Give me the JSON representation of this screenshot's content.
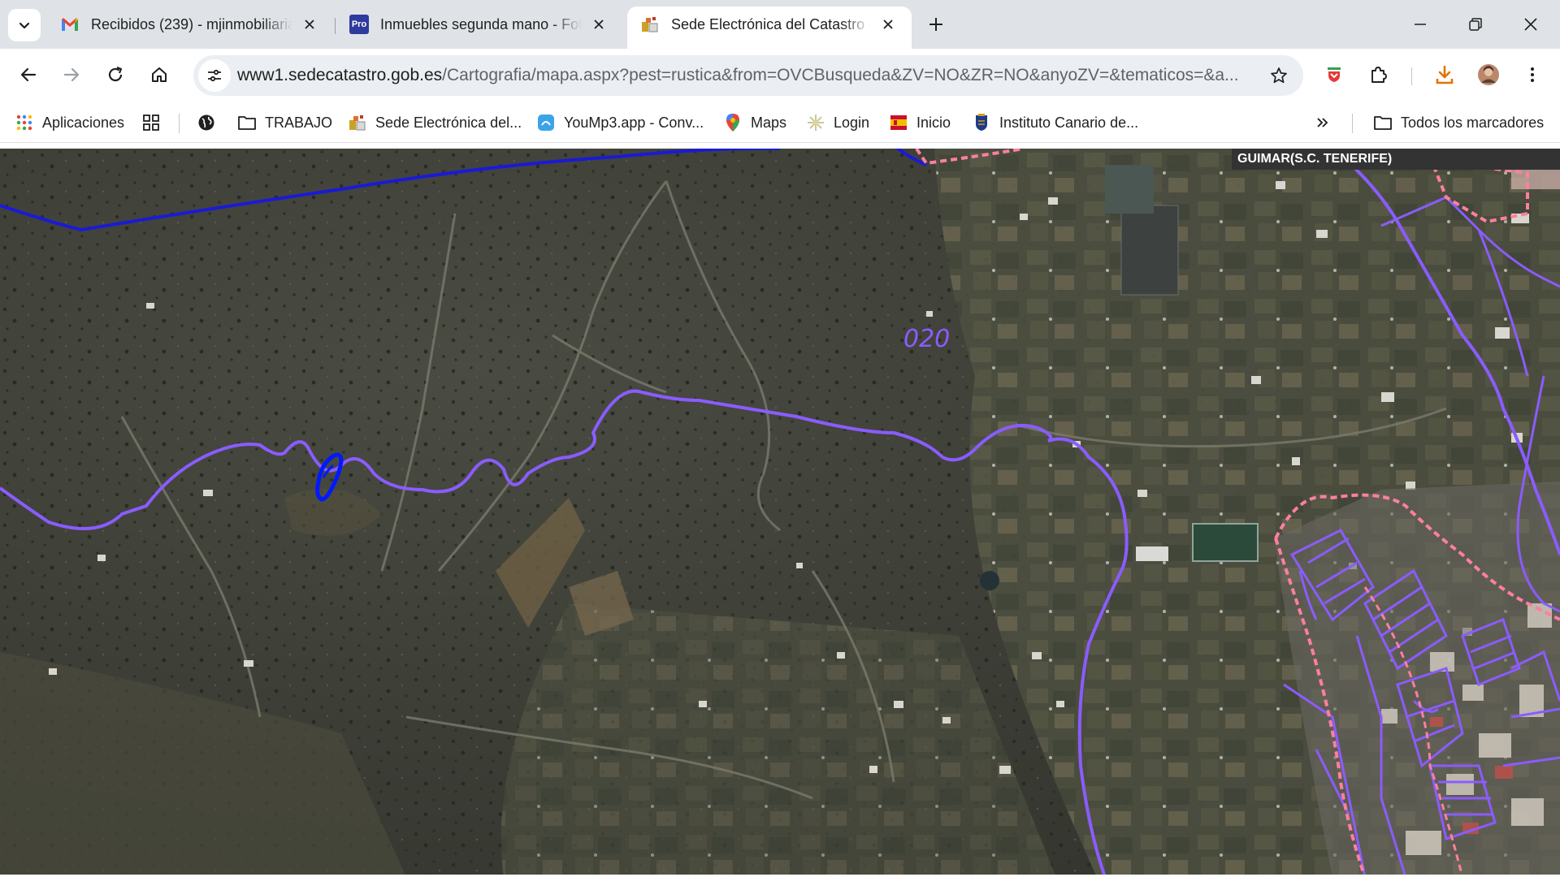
{
  "tabs": [
    {
      "title": "Recibidos (239) - mjinmobiliaria",
      "favicon": "gmail-icon",
      "active": false
    },
    {
      "title": "Inmuebles segunda mano - Fot",
      "favicon": "pro-icon",
      "favicon_text": "Pro",
      "active": false
    },
    {
      "title": "Sede Electrónica del Catastro - ",
      "favicon": "catastro-icon",
      "active": true
    }
  ],
  "toolbar": {
    "url_host": "www1.sedecatastro.gob.es",
    "url_path": "/Cartografia/mapa.aspx?pest=rustica&from=OVCBusqueda&ZV=NO&ZR=NO&anyoZV=&tematicos=&a..."
  },
  "bookmarks": {
    "apps_label": "Aplicaciones",
    "items": [
      {
        "label": "TRABAJO",
        "icon": "folder-icon"
      },
      {
        "label": "Sede Electrónica del...",
        "icon": "catastro-icon"
      },
      {
        "label": "YouMp3.app - Conv...",
        "icon": "yoump3-icon"
      },
      {
        "label": "Maps",
        "icon": "maps-pin-icon"
      },
      {
        "label": "Login",
        "icon": "login-icon"
      },
      {
        "label": "Inicio",
        "icon": "inicio-icon"
      },
      {
        "label": "Instituto Canario de...",
        "icon": "instituto-icon"
      }
    ],
    "all_bookmarks_label": "Todos los marcadores"
  },
  "map": {
    "municipality_label": "GUIMAR(S.C. TENERIFE)",
    "polygon_label": "020"
  },
  "colors": {
    "boundary_blue": "#1a1ad6",
    "parcel_outline": "#8a5cff",
    "urban_dashed": "#ff7f9e",
    "selected_parcel": "#0019ff"
  }
}
